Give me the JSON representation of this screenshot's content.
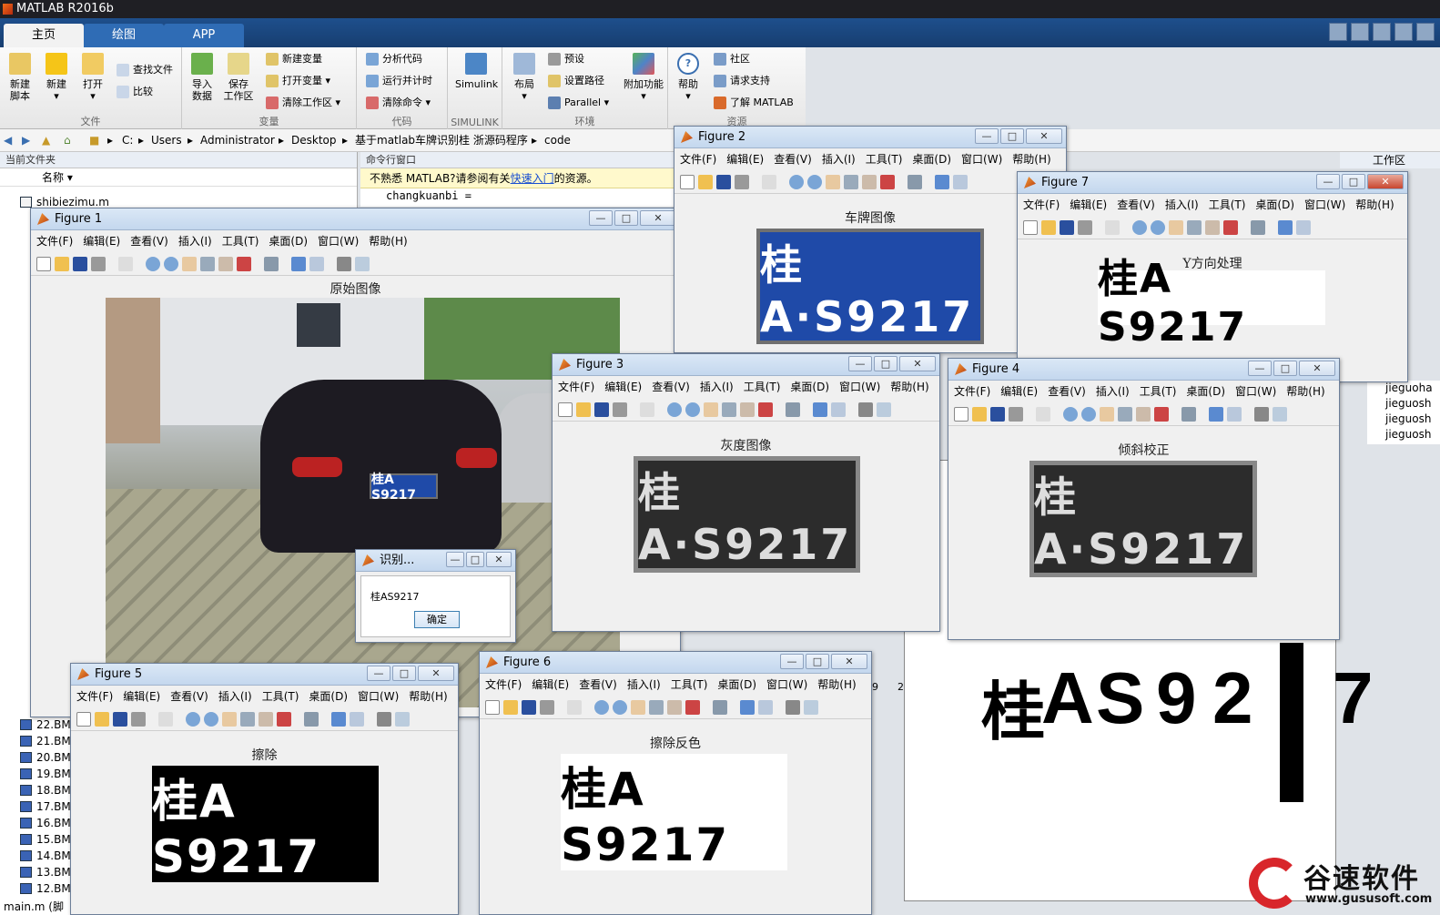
{
  "app": {
    "title": "MATLAB R2016b"
  },
  "tabs": [
    "主页",
    "绘图",
    "APP"
  ],
  "ribbon": {
    "file": {
      "label": "文件",
      "new_script": "新建\n脚本",
      "new": "新建",
      "open": "打开",
      "find_files": "查找文件",
      "compare": "比较"
    },
    "variable": {
      "label": "变量",
      "import": "导入\n数据",
      "save_ws": "保存\n工作区",
      "new_var": "新建变量",
      "open_var": "打开变量",
      "clear_ws": "清除工作区"
    },
    "code": {
      "label": "代码",
      "analyze": "分析代码",
      "run_time": "运行并计时",
      "clear_cmd": "清除命令"
    },
    "simulink": {
      "label": "SIMULINK",
      "simulink": "Simulink"
    },
    "env": {
      "label": "环境",
      "layout": "布局",
      "prefs": "预设",
      "set_path": "设置路径",
      "parallel": "Parallel",
      "addons": "附加功能"
    },
    "resources": {
      "label": "资源",
      "help": "帮助",
      "community": "社区",
      "support": "请求支持",
      "learn": "了解 MATLAB"
    }
  },
  "address": [
    "C:",
    "Users",
    "Administrator",
    "Desktop",
    "基于matlab车牌识别桂 浙源码程序",
    "code"
  ],
  "panels": {
    "current_folder": "当前文件夹",
    "name_col": "名称",
    "command_window": "命令行窗口",
    "cmd_hint_pre": "不熟悉 MATLAB?请参阅有关",
    "cmd_hint_link": "快速入门",
    "cmd_hint_post": "的资源。",
    "cmd_line": "changkuanbi =",
    "workspace": "工作区"
  },
  "files": [
    "shibiezimu.m",
    "22.BM",
    "21.BM",
    "20.BM",
    "19.BM",
    "18.BM",
    "17.BM",
    "16.BM",
    "15.BM",
    "14.BM",
    "13.BM",
    "12.BM",
    "main.m (脚"
  ],
  "right_files": [
    "jieguoha",
    "jieguosh",
    "jieguosh",
    "jieguosh"
  ],
  "menus": [
    "文件(F)",
    "编辑(E)",
    "查看(V)",
    "插入(I)",
    "工具(T)",
    "桌面(D)",
    "窗口(W)",
    "帮助(H)"
  ],
  "figures": {
    "f1": {
      "title": "Figure 1",
      "caption": "原始图像"
    },
    "f2": {
      "title": "Figure 2",
      "caption": "车牌图像"
    },
    "f3": {
      "title": "Figure 3",
      "caption": "灰度图像"
    },
    "f4": {
      "title": "Figure 4",
      "caption": "倾斜校正"
    },
    "f5": {
      "title": "Figure 5",
      "caption": "擦除"
    },
    "f6": {
      "title": "Figure 6",
      "caption": "擦除反色"
    },
    "f7": {
      "title": "Figure 7",
      "caption": "Y方向处理"
    }
  },
  "plate_text": "桂A·S9217",
  "plate_plain": "桂A S9217",
  "big_chars": [
    "桂",
    "A",
    "S",
    "9",
    "2",
    "7"
  ],
  "dialog": {
    "title": "识别...",
    "result": "桂AS9217",
    "ok": "确定"
  },
  "axis_ticks": [
    "9",
    "2"
  ],
  "watermark": {
    "brand": "谷速软件",
    "url": "www.gususoft.com"
  },
  "colors": {
    "ribbon_blue": "#1e4f8c",
    "plate_blue": "#1f4aa8",
    "watermark_red": "#d8262b"
  }
}
